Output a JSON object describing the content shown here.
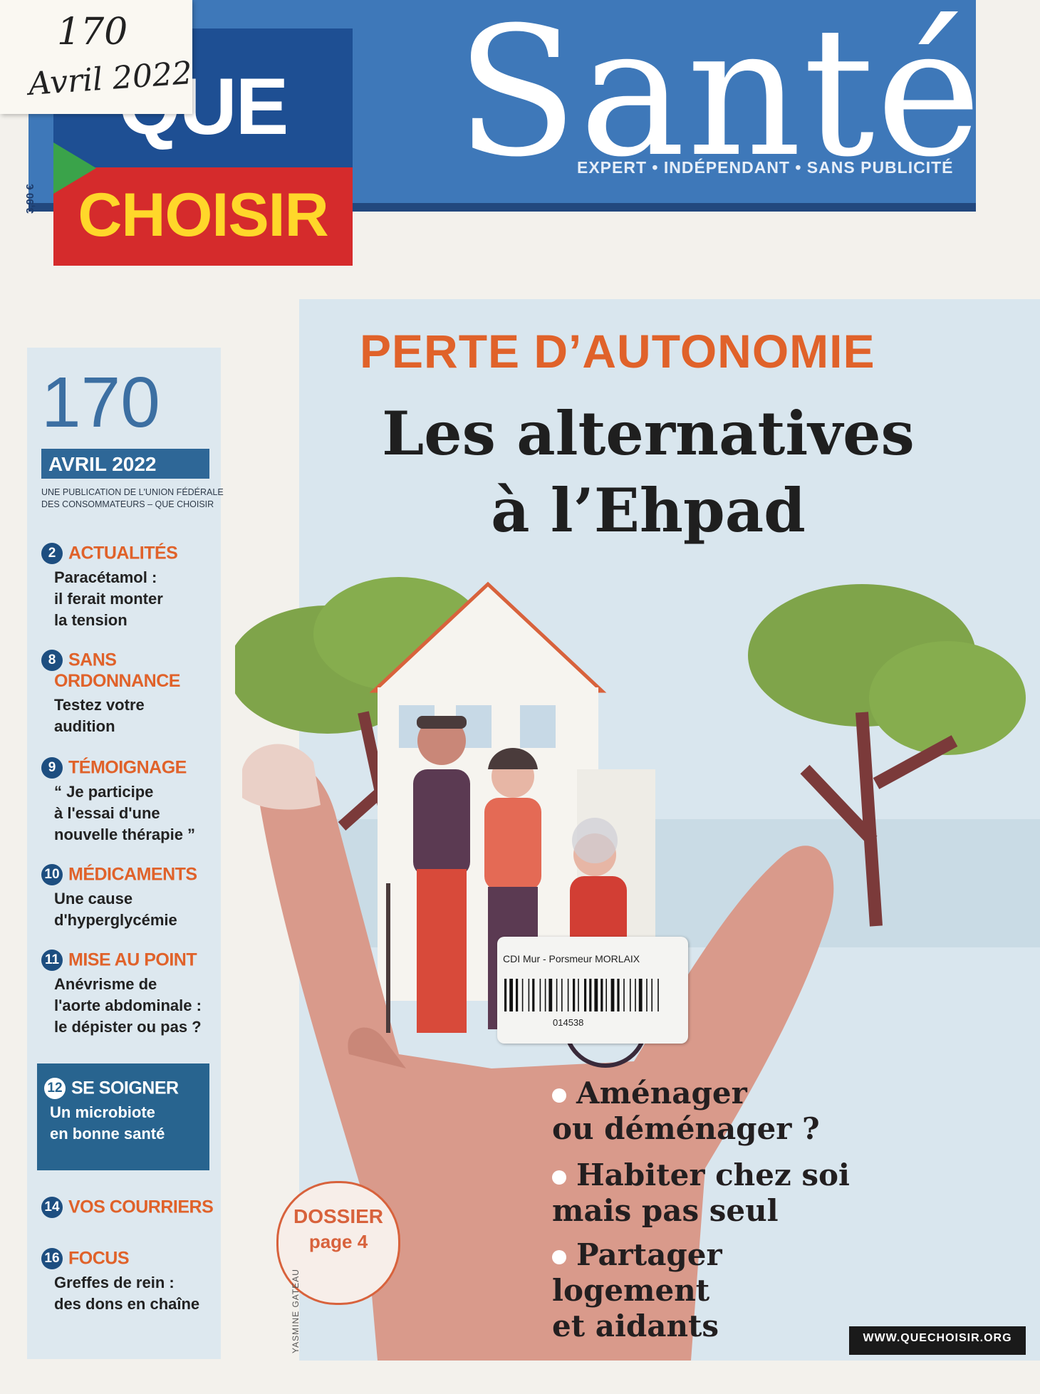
{
  "sticky_note": {
    "line1": "170",
    "line2": "Avril 2022"
  },
  "masthead": {
    "price": "3,90 €",
    "brand_top": "QUE",
    "brand_bottom": "CHOISIR",
    "title": "Santé",
    "tagline": "EXPERT • INDÉPENDANT • SANS PUBLICITÉ"
  },
  "issue": {
    "number": "170",
    "date": "AVRIL 2022",
    "publisher": "UNE PUBLICATION DE L'UNION FÉDÉRALE DES CONSOMMATEURS – QUE CHOISIR"
  },
  "toc": [
    {
      "page": "2",
      "section": "ACTUALITÉS",
      "desc": [
        "Paracétamol :",
        "il ferait monter",
        "la tension"
      ]
    },
    {
      "page": "8",
      "section": "SANS ORDONNANCE",
      "section_lines": [
        "SANS",
        "ORDONNANCE"
      ],
      "desc": [
        "Testez votre",
        "audition"
      ]
    },
    {
      "page": "9",
      "section": "TÉMOIGNAGE",
      "desc": [
        "“ Je participe",
        "à l'essai d'une",
        "nouvelle thérapie ”"
      ]
    },
    {
      "page": "10",
      "section": "MÉDICAMENTS",
      "desc": [
        "Une cause",
        "d'hyperglycémie"
      ]
    },
    {
      "page": "11",
      "section": "MISE AU POINT",
      "desc": [
        "Anévrisme de",
        "l'aorte abdominale :",
        "le dépister ou pas ?"
      ]
    },
    {
      "page": "12",
      "section": "SE SOIGNER",
      "desc": [
        "Un microbiote",
        "en bonne santé"
      ]
    },
    {
      "page": "14",
      "section": "VOS COURRIERS",
      "desc": []
    },
    {
      "page": "16",
      "section": "FOCUS",
      "desc": [
        "Greffes de rein :",
        "des dons en chaîne"
      ]
    }
  ],
  "cover": {
    "kicker": "PERTE D’AUTONOMIE",
    "headline_line1": "Les alternatives",
    "headline_line2": "à l’Ehpad",
    "bullets": [
      [
        "Aménager",
        "ou déménager ?"
      ],
      [
        "Habiter chez soi",
        "mais pas seul"
      ],
      [
        "Partager",
        "logement",
        "et aidants"
      ]
    ],
    "dossier_title": "DOSSIER",
    "dossier_page": "page 4",
    "credit": "YASMINE GATEAU",
    "website": "WWW.QUECHOISIR.ORG"
  },
  "sticker": {
    "label": "CDI Mur - Porsmeur MORLAIX",
    "code": "014538"
  },
  "colors": {
    "masthead_blue": "#3e78b9",
    "que_blue": "#1e4f93",
    "choisir_red": "#d52b2c",
    "choisir_yellow": "#ffd72a",
    "accent_orange": "#e0622a",
    "sidebar_blue": "#28648f"
  }
}
